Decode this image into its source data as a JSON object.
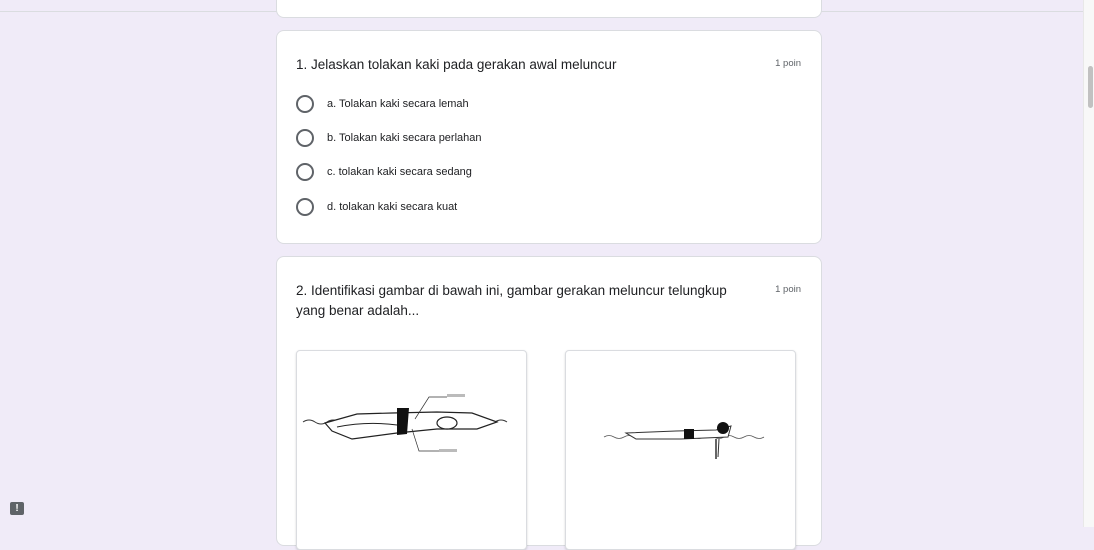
{
  "questions": [
    {
      "title": "1. Jelaskan tolakan kaki pada gerakan awal meluncur",
      "points": "1 poin",
      "options": [
        "a. Tolakan kaki secara lemah",
        "b. Tolakan kaki secara perlahan",
        "c. tolakan kaki secara sedang",
        "d. tolakan kaki secara kuat"
      ]
    },
    {
      "title": "2. Identifikasi gambar di bawah ini, gambar gerakan meluncur telungkup yang benar adalah...",
      "points": "1 poin"
    }
  ],
  "feedback": {
    "icon": "feedback-icon",
    "glyph": "!"
  },
  "colors": {
    "background": "#f0ebf8",
    "card": "#ffffff",
    "radio": "#5f6368"
  }
}
